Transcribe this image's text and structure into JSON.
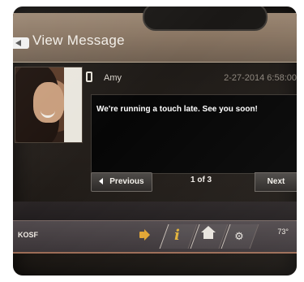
{
  "header": {
    "clock_text": "",
    "title": "View Message"
  },
  "message": {
    "sender": "Amy",
    "timestamp": "2-27-2014 6:58:00",
    "body": "We're running a touch late. See you soon!"
  },
  "pager": {
    "previous_label": "Previous",
    "page_text": "1 of 3",
    "next_label": "Next"
  },
  "status_bar": {
    "station": "KOSF",
    "temperature": "73°"
  },
  "icons": {
    "back": "back-arrow-icon",
    "phone": "phone-icon",
    "volume": "speaker-icon",
    "info": "info-icon",
    "home": "home-icon",
    "settings": "settings-icon"
  },
  "colors": {
    "accent_gold": "#e1b23a",
    "header_brown": "#8a7663",
    "message_bg": "#060606"
  }
}
